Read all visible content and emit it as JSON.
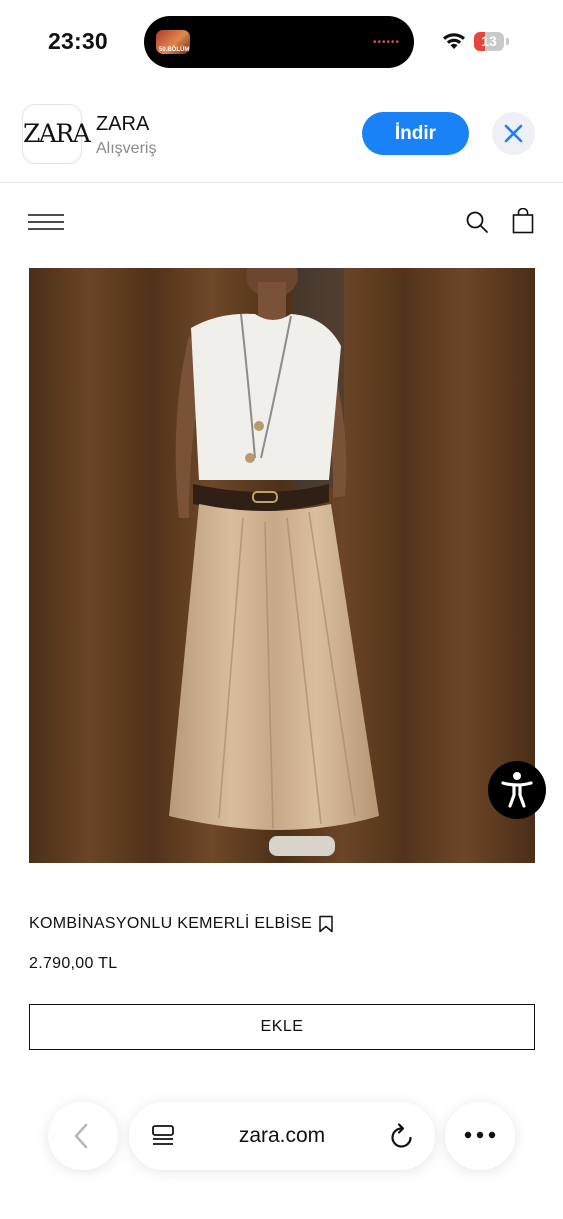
{
  "status_bar": {
    "time": "23:30",
    "island_thumbnail_label": "50.BÖLÜM",
    "battery": "13",
    "battery_color": "#e5453a"
  },
  "app_banner": {
    "icon_text": "ZARA",
    "app_name": "ZARA",
    "category": "Alışveriş",
    "install_label": "İndir",
    "accent_color": "#1a82f7"
  },
  "site_header": {
    "icons": [
      "menu-icon",
      "search-icon",
      "shopping-bag-icon"
    ]
  },
  "product": {
    "name": "KOMBİNASYONLU KEMERLİ ELBİSE",
    "price": "2.790,00 TL",
    "add_button_label": "EKLE"
  },
  "browser_bar": {
    "url": "zara.com",
    "icons": [
      "back-icon",
      "reader-icon",
      "reload-icon",
      "more-icon"
    ]
  }
}
